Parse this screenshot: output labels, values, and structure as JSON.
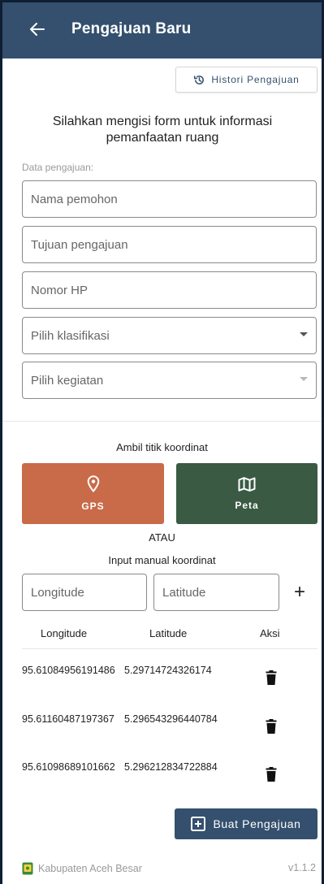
{
  "appbar": {
    "title": "Pengajuan Baru"
  },
  "histori_button": {
    "label": "Histori Pengajuan"
  },
  "intro_text": "Silahkan mengisi form untuk informasi pemanfaatan ruang",
  "section_label": "Data pengajuan:",
  "fields": {
    "nama": "Nama pemohon",
    "tujuan": "Tujuan pengajuan",
    "nomor": "Nomor HP",
    "klasifikasi": "Pilih klasifikasi",
    "kegiatan": "Pilih kegiatan"
  },
  "coordinate": {
    "title": "Ambil titik koordinat",
    "gps_label": "GPS",
    "peta_label": "Peta",
    "or_label": "ATAU",
    "manual_label": "Input manual koordinat",
    "longitude_placeholder": "Longitude",
    "latitude_placeholder": "Latitude",
    "add_symbol": "+"
  },
  "table": {
    "headers": {
      "longitude": "Longitude",
      "latitude": "Latitude",
      "aksi": "Aksi"
    },
    "rows": [
      {
        "longitude": "95.61084956191486",
        "latitude": "5.29714724326174"
      },
      {
        "longitude": "95.61160487197367",
        "latitude": "5.296543296440784"
      },
      {
        "longitude": "95.61098689101662",
        "latitude": "5.296212834722884"
      }
    ]
  },
  "submit_button": {
    "label": "Buat Pengajuan"
  },
  "footer": {
    "org": "Kabupaten Aceh Besar",
    "version": "v1.1.2"
  },
  "colors": {
    "primary": "#34506e",
    "gps": "#c96a48",
    "peta": "#3a5a44"
  }
}
